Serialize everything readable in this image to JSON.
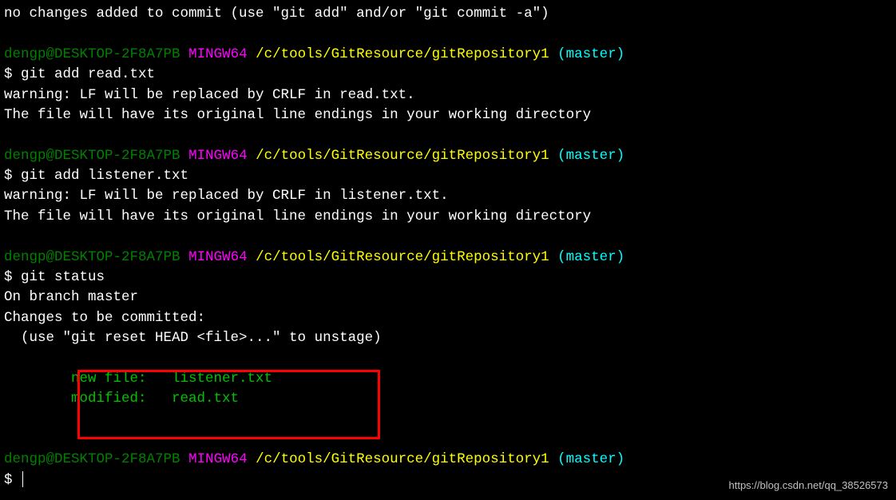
{
  "terminal": {
    "line_no_changes": "no changes added to commit (use \"git add\" and/or \"git commit -a\")",
    "prompt_user": "dengp@DESKTOP-2F8A7PB",
    "prompt_space1": " ",
    "prompt_mingw": "MINGW64",
    "prompt_space2": " ",
    "prompt_path": "/c/tools/GitResource/gitRepository1",
    "prompt_space3": " ",
    "prompt_branch": "(master)",
    "dollar": "$ ",
    "cmd_add_read": "git add read.txt",
    "warn_crlf_read": "warning: LF will be replaced by CRLF in read.txt.",
    "warn_line_endings": "The file will have its original line endings in your working directory",
    "cmd_add_listener": "git add listener.txt",
    "warn_crlf_listener": "warning: LF will be replaced by CRLF in listener.txt.",
    "cmd_status": "git status",
    "status_branch": "On branch master",
    "status_changes": "Changes to be committed:",
    "status_unstage": "  (use \"git reset HEAD <file>...\" to unstage)",
    "status_new_file": "        new file:   listener.txt",
    "status_modified": "        modified:   read.txt",
    "dollar_only": "$ "
  },
  "highlight": {
    "top": "463",
    "left": "97",
    "width": "373",
    "height": "81"
  },
  "watermark": "https://blog.csdn.net/qq_38526573"
}
